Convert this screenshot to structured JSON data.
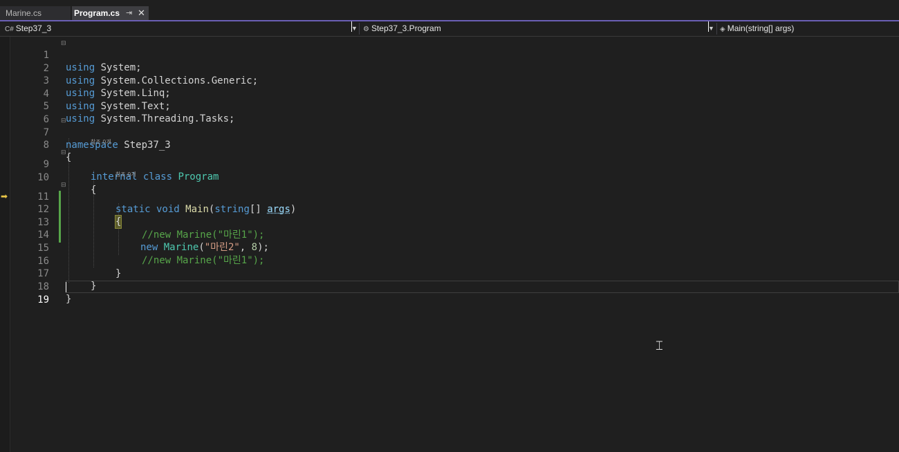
{
  "tabs": [
    {
      "label": "Marine.cs",
      "active": false
    },
    {
      "label": "Program.cs",
      "active": true,
      "pin_icon": "pin-icon",
      "close_icon": "close-icon"
    }
  ],
  "navbar": {
    "project": "Step37_3",
    "class": "Step37_3.Program",
    "member": "Main(string[] args)"
  },
  "references": {
    "class_refs": "참조 0개",
    "method_refs": "참조 0개"
  },
  "line_numbers": [
    "1",
    "2",
    "3",
    "4",
    "5",
    "6",
    "7",
    "8",
    "9",
    "10",
    "11",
    "12",
    "13",
    "14",
    "15",
    "16",
    "17",
    "18",
    "19"
  ],
  "code": {
    "l1": {
      "kw": "using",
      "rest": " System;"
    },
    "l2": {
      "kw": "using",
      "rest": " System.Collections.Generic;"
    },
    "l3": {
      "kw": "using",
      "rest": " System.Linq;"
    },
    "l4": {
      "kw": "using",
      "rest": " System.Text;"
    },
    "l5": {
      "kw": "using",
      "rest": " System.Threading.Tasks;"
    },
    "l7": {
      "kw": "namespace",
      "rest": " Step37_3"
    },
    "l8": "{",
    "l9": {
      "kw": "internal class",
      "type": "Program"
    },
    "l10": "{",
    "l11": {
      "kw1": "static void",
      "fn": "Main",
      "open": "(",
      "kw2": "string",
      "mid": "[] ",
      "param": "args",
      "close": ")"
    },
    "l12": "{",
    "l13": "//new Marine(\"마린1\");",
    "l14": {
      "kw": "new",
      "type": "Marine",
      "open": "(",
      "str": "\"마린2\"",
      "comma": ", ",
      "num": "8",
      "close": ");"
    },
    "l15": "//new Marine(\"마린1\");",
    "l16": "}",
    "l17": "}",
    "l18": "}"
  },
  "colors": {
    "keyword": "#569cd6",
    "type": "#4ec9b0",
    "method": "#dcdcaa",
    "string": "#d69d85",
    "comment": "#57a64a",
    "tab_accent": "#6b5fb5"
  }
}
